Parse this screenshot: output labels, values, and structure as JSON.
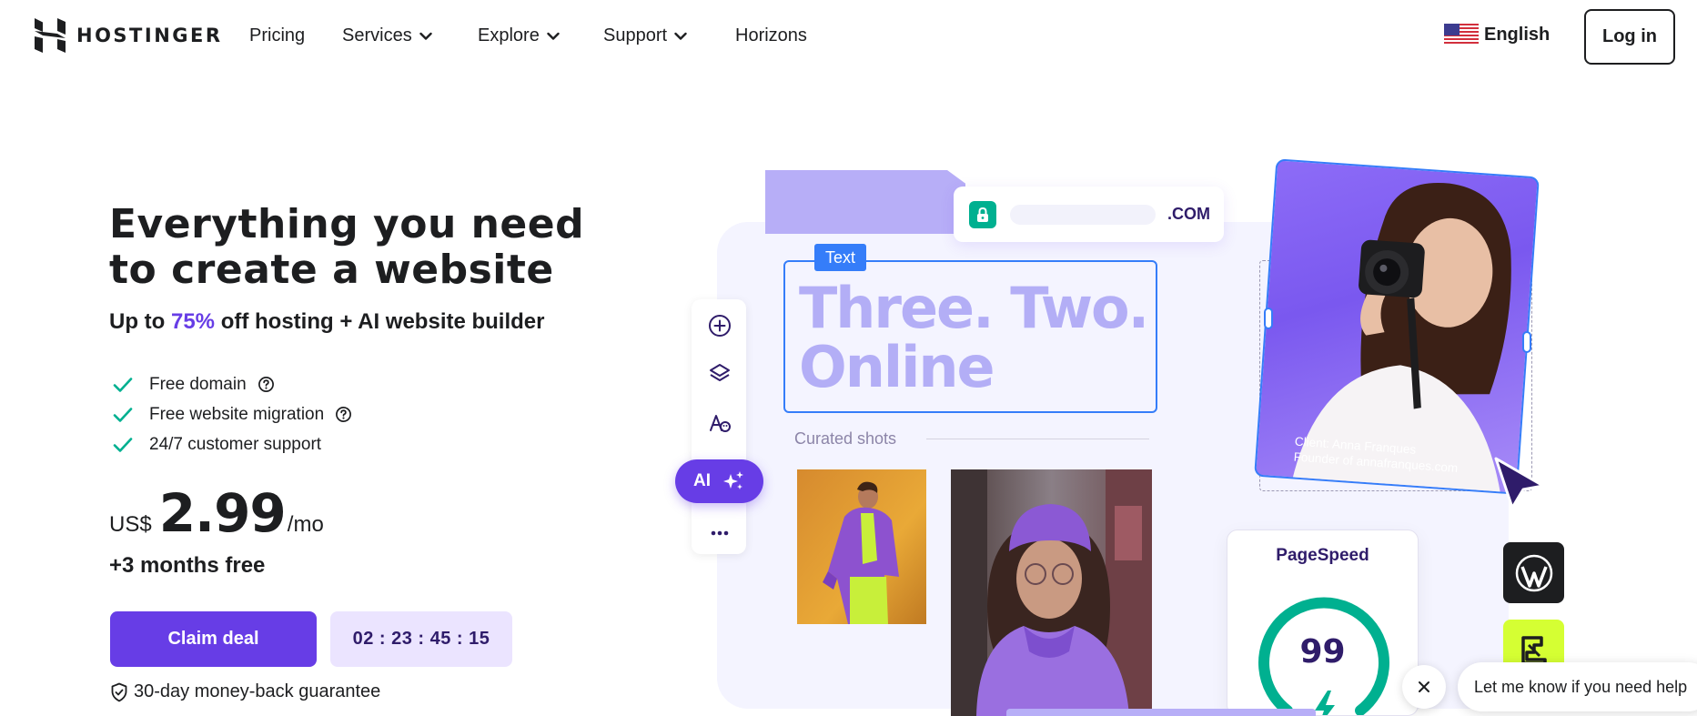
{
  "nav": {
    "brand": "HOSTINGER",
    "links": [
      {
        "label": "Pricing"
      },
      {
        "label": "Services"
      },
      {
        "label": "Explore"
      },
      {
        "label": "Support"
      },
      {
        "label": "Horizons"
      }
    ],
    "language": "English",
    "login": "Log in"
  },
  "hero": {
    "title": "Everything you need to create a website",
    "subtitle_prefix": "Up to ",
    "subtitle_discount": "75%",
    "subtitle_suffix": " off hosting + AI website builder",
    "features": [
      {
        "label": "Free domain",
        "has_help": true
      },
      {
        "label": "Free website migration",
        "has_help": true
      },
      {
        "label": "24/7 customer support",
        "has_help": false
      }
    ],
    "price": {
      "currency": "US$",
      "amount": "2.99",
      "period": "/mo"
    },
    "bonus": "+3 months free",
    "cta": "Claim deal",
    "countdown": "02 : 23 : 45 : 15",
    "guarantee": "30-day money-back guarantee"
  },
  "illustration": {
    "domain_tld": ".COM",
    "text_tag": "Text",
    "headline_line1": "Three. Two.",
    "headline_line2": "Online",
    "curated_label": "Curated shots",
    "ai_button": "AI",
    "portrait_caption_1": "Client: Anna Franques",
    "portrait_caption_2": "Founder of annafranques.com",
    "pagespeed_title": "PageSpeed",
    "pagespeed_score": "99",
    "accent_color": "#673de6",
    "success_color": "#00b090"
  },
  "chat": {
    "message": "Let me know if you need help"
  }
}
